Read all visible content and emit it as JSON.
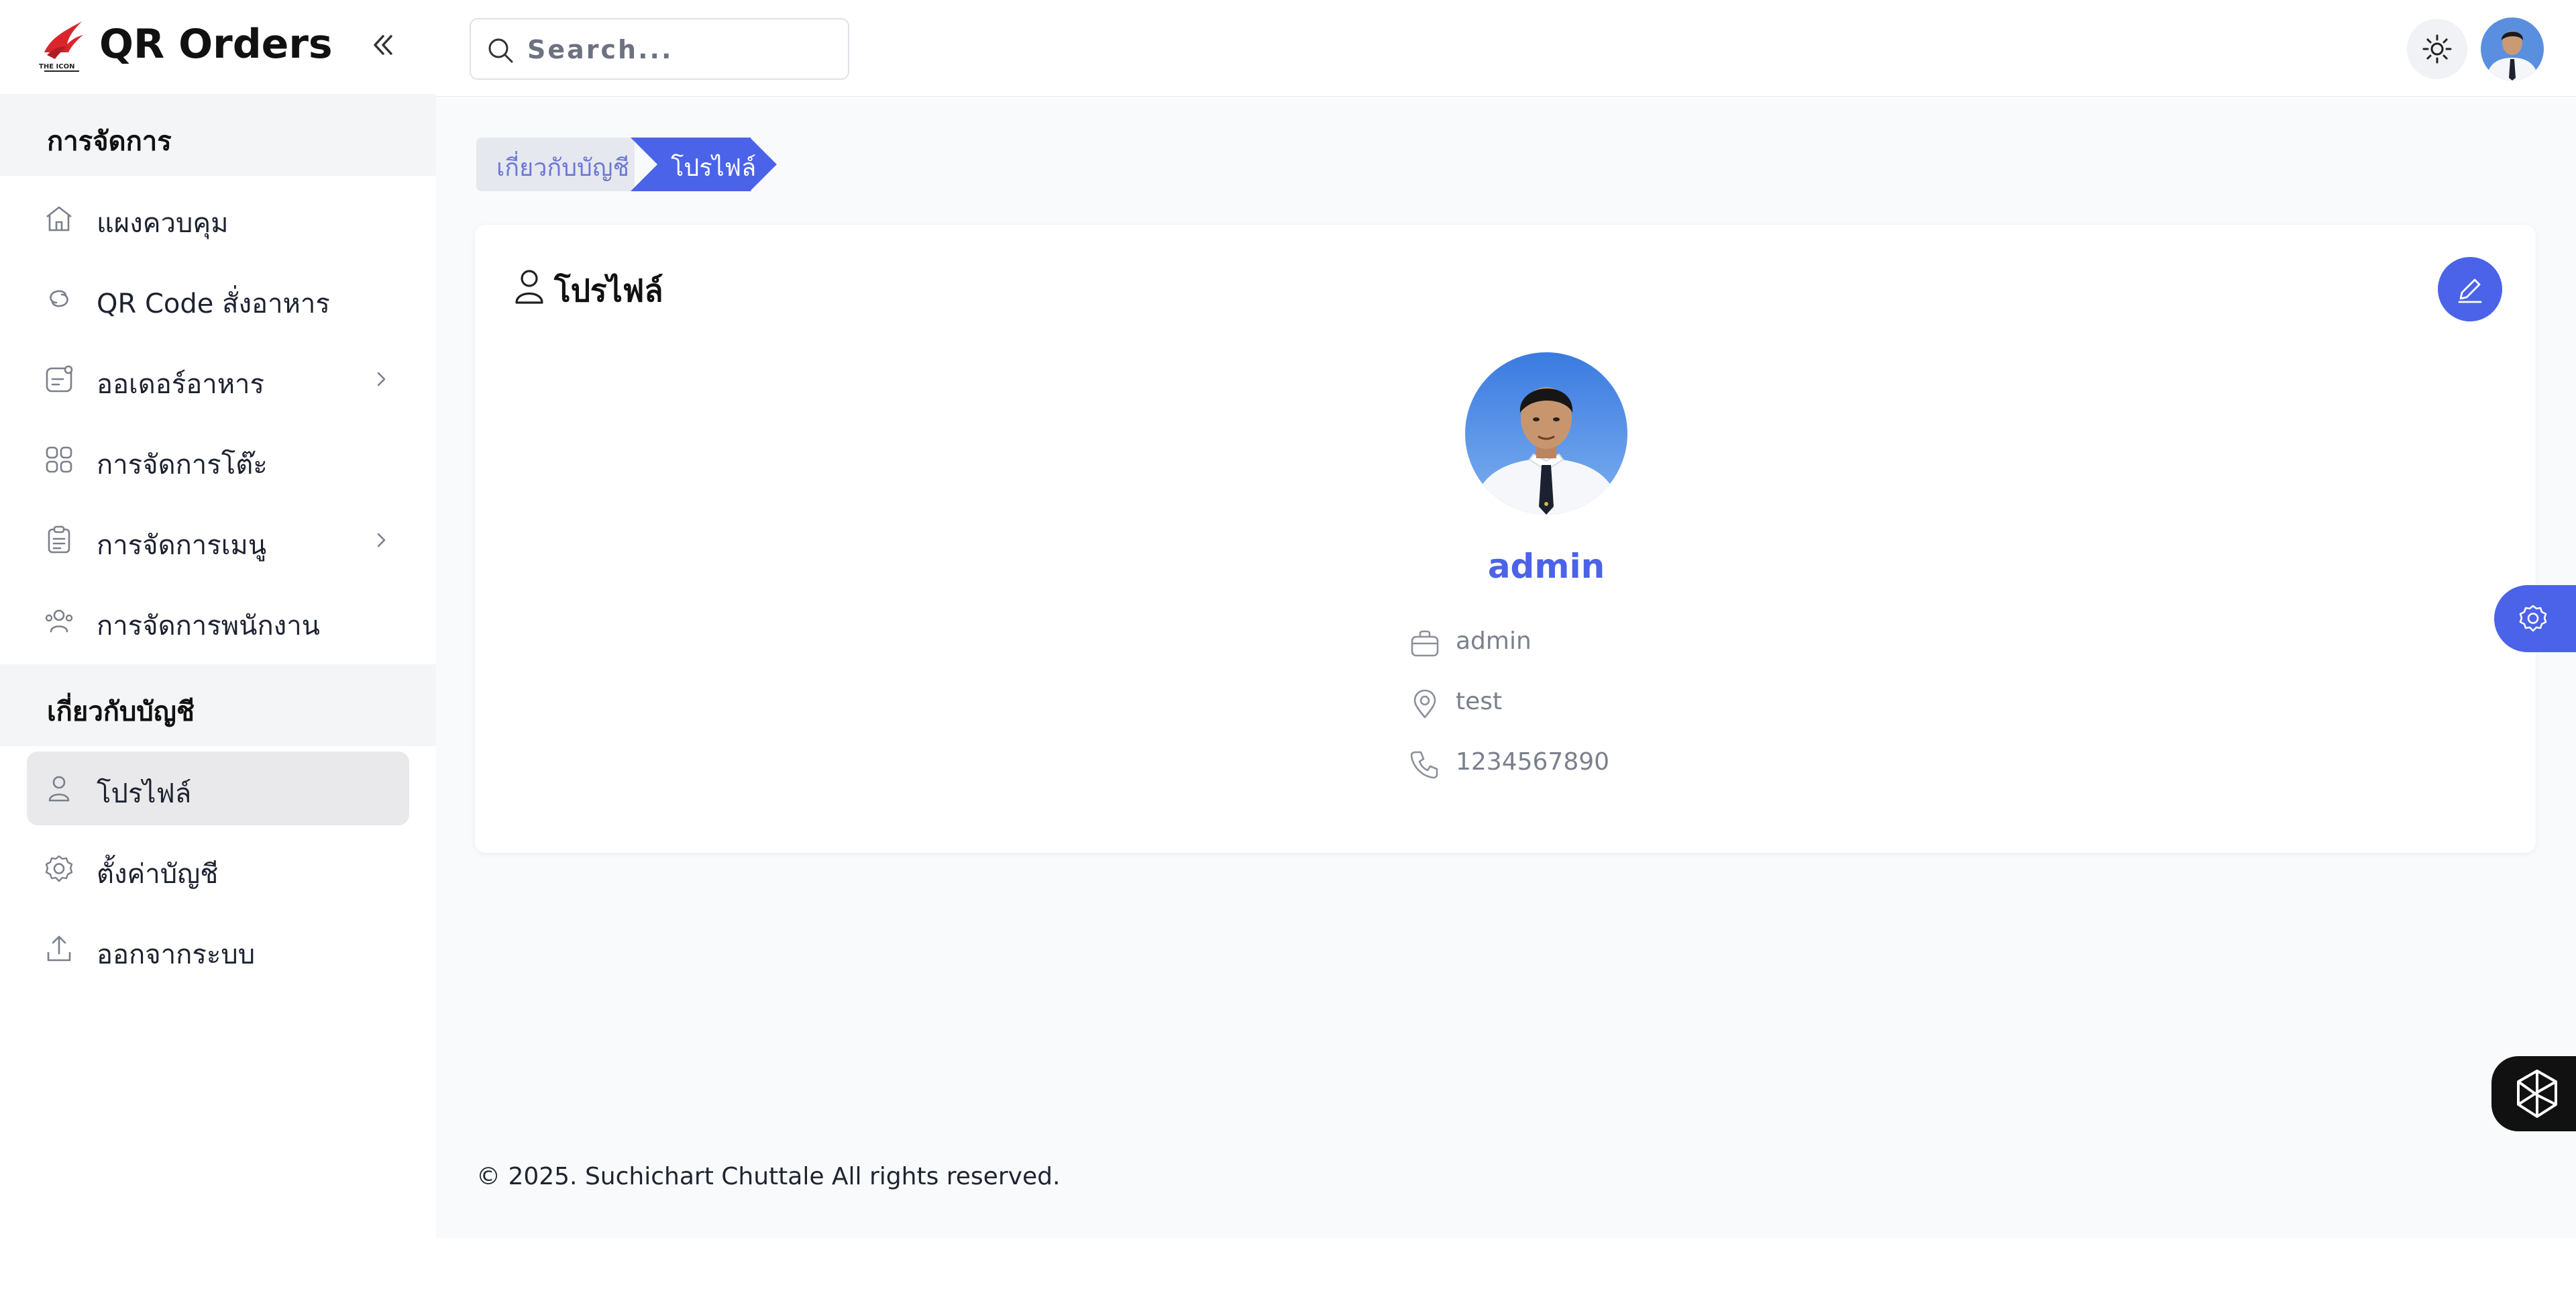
{
  "app": {
    "title": "QR Orders",
    "logo_icon": "phoenix-logo-icon",
    "logo_text": "THE ICON"
  },
  "colors": {
    "accent": "#4a63e8",
    "logo_red": "#d9262c"
  },
  "sidebar": {
    "collapse_icon": "double-chevron-left-icon",
    "sections": [
      {
        "title": "การจัดการ",
        "items": [
          {
            "label": "แผงควบคุม",
            "icon": "home-icon",
            "has_submenu": false
          },
          {
            "label": "QR Code สั่งอาหาร",
            "icon": "link-icon",
            "has_submenu": false
          },
          {
            "label": "ออเดอร์อาหาร",
            "icon": "order-icon",
            "has_submenu": true
          },
          {
            "label": "การจัดการโต๊ะ",
            "icon": "grid-icon",
            "has_submenu": false
          },
          {
            "label": "การจัดการเมนู",
            "icon": "clipboard-icon",
            "has_submenu": true
          },
          {
            "label": "การจัดการพนักงาน",
            "icon": "users-icon",
            "has_submenu": false
          }
        ]
      },
      {
        "title": "เกี่ยวกับบัญชี",
        "items": [
          {
            "label": "โปรไฟล์",
            "icon": "user-icon",
            "active": true
          },
          {
            "label": "ตั้งค่าบัญชี",
            "icon": "gear-icon"
          },
          {
            "label": "ออกจากระบบ",
            "icon": "logout-icon"
          }
        ]
      }
    ]
  },
  "topbar": {
    "search_placeholder": "Search...",
    "search_icon": "search-icon",
    "theme_icon": "sun-icon",
    "avatar": "user-avatar"
  },
  "breadcrumb": [
    "เกี่ยวกับบัญชี",
    "โปรไฟล์"
  ],
  "profile": {
    "title": "โปรไฟล์",
    "title_icon": "user-icon",
    "edit_icon": "pencil-icon",
    "name": "admin",
    "details": [
      {
        "icon": "briefcase-icon",
        "value": "admin"
      },
      {
        "icon": "location-pin-icon",
        "value": "test"
      },
      {
        "icon": "phone-icon",
        "value": "1234567890"
      }
    ]
  },
  "footer": {
    "text": "© 2025. Suchichart Chuttale All rights reserved."
  },
  "floating": {
    "settings_icon": "gear-icon",
    "assistant_icon": "ai-assistant-icon"
  }
}
